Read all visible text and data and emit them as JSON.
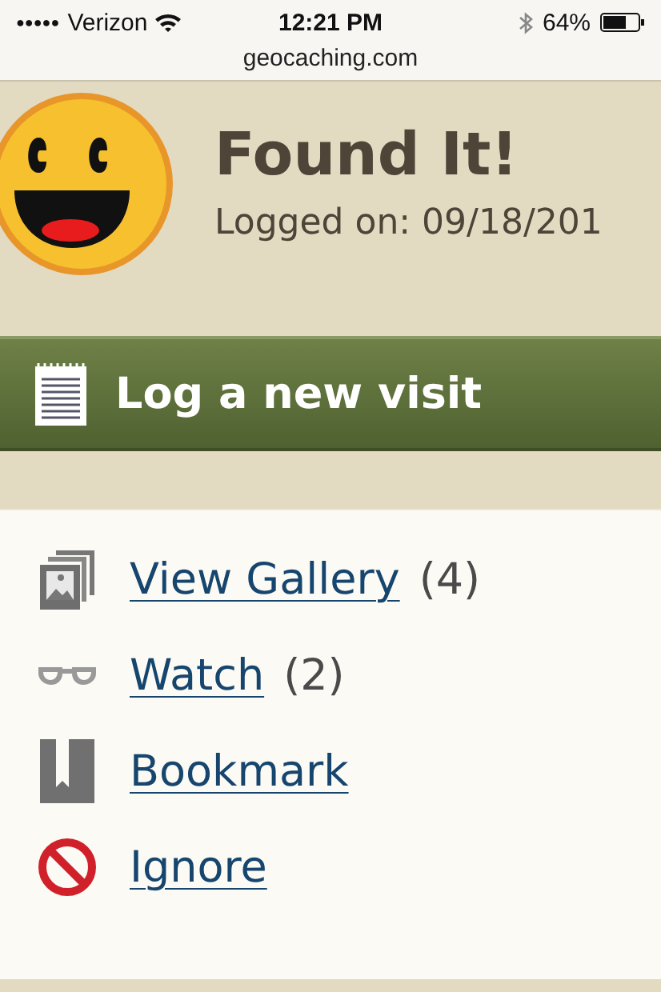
{
  "status_bar": {
    "signal_dots": "●●●●●",
    "carrier": "Verizon",
    "time": "12:21 PM",
    "battery": "64%"
  },
  "address_bar": {
    "url": "geocaching.com"
  },
  "log": {
    "title": "Found It!",
    "logged_on": "Logged on: 09/18/201"
  },
  "log_button": {
    "label": "Log a new visit"
  },
  "actions": [
    {
      "kind": "gallery",
      "label": "View Gallery",
      "count": "(4)"
    },
    {
      "kind": "watch",
      "label": "Watch",
      "count": "(2)"
    },
    {
      "kind": "bookmark",
      "label": "Bookmark"
    },
    {
      "kind": "ignore",
      "label": "Ignore"
    }
  ]
}
